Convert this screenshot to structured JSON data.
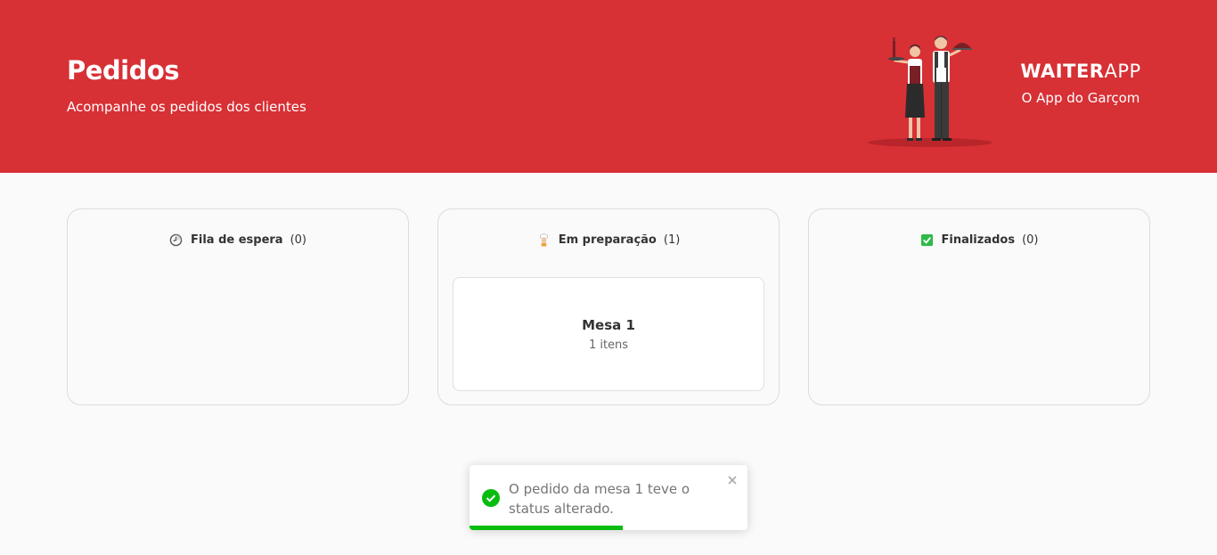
{
  "header": {
    "title": "Pedidos",
    "subtitle": "Acompanhe os pedidos dos clientes",
    "brand_strong": "WAITER",
    "brand_light": "APP",
    "brand_tagline": "O App do Garçom",
    "illustration_icon": "waiters-illustration"
  },
  "boards": [
    {
      "icon": "clock-icon",
      "title": "Fila de espera",
      "count": "(0)"
    },
    {
      "icon": "chef-icon",
      "title": "Em preparação",
      "count": "(1)",
      "orders": [
        {
          "table": "Mesa 1",
          "items": "1 itens"
        }
      ]
    },
    {
      "icon": "check-square-icon",
      "title": "Finalizados",
      "count": "(0)"
    }
  ],
  "toast": {
    "message": "O pedido da mesa 1 teve o status alterado.",
    "type": "success",
    "progress": 0.55
  },
  "colors": {
    "brand_red": "#d73035",
    "success_green": "#07bc0c",
    "check_green": "#30b94a"
  }
}
